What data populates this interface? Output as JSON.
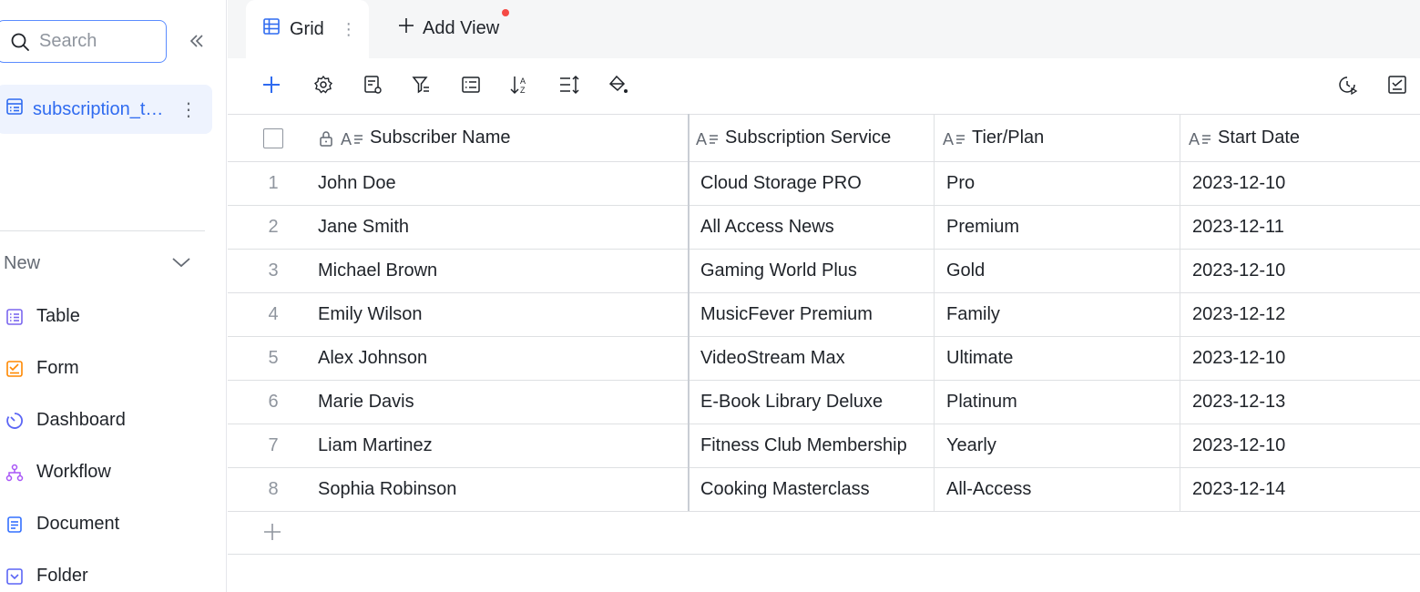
{
  "sidebar": {
    "search_placeholder": "Search",
    "active_table": "subscription_t…",
    "new_label": "New",
    "new_items": [
      {
        "label": "Table",
        "icon": "table-icon",
        "color": "#7b67ee"
      },
      {
        "label": "Form",
        "icon": "form-icon",
        "color": "#ff8800"
      },
      {
        "label": "Dashboard",
        "icon": "dashboard-icon",
        "color": "#5b65f5"
      },
      {
        "label": "Workflow",
        "icon": "workflow-icon",
        "color": "#a855f7"
      },
      {
        "label": "Document",
        "icon": "document-icon",
        "color": "#3370ff"
      },
      {
        "label": "Folder",
        "icon": "folder-icon",
        "color": "#5b65f5"
      }
    ]
  },
  "tabs": {
    "grid_label": "Grid",
    "add_view_label": "Add View"
  },
  "toolbar": {
    "icons": [
      "add-record-icon",
      "settings-icon",
      "field-settings-icon",
      "filter-icon",
      "group-icon",
      "sort-icon",
      "row-height-icon",
      "fill-color-icon"
    ],
    "right_icons": [
      "history-icon",
      "task-icon"
    ]
  },
  "grid": {
    "columns": [
      "Subscriber Name",
      "Subscription Service",
      "Tier/Plan",
      "Start Date"
    ],
    "rows": [
      {
        "num": "1",
        "name": "John Doe",
        "service": "Cloud Storage PRO",
        "tier": "Pro",
        "date": "2023-12-10"
      },
      {
        "num": "2",
        "name": "Jane Smith",
        "service": "All Access News",
        "tier": "Premium",
        "date": "2023-12-11"
      },
      {
        "num": "3",
        "name": "Michael Brown",
        "service": "Gaming World Plus",
        "tier": "Gold",
        "date": "2023-12-10"
      },
      {
        "num": "4",
        "name": "Emily Wilson",
        "service": "MusicFever Premium",
        "tier": "Family",
        "date": "2023-12-12"
      },
      {
        "num": "5",
        "name": "Alex Johnson",
        "service": "VideoStream Max",
        "tier": "Ultimate",
        "date": "2023-12-10"
      },
      {
        "num": "6",
        "name": "Marie Davis",
        "service": "E-Book Library Deluxe",
        "tier": "Platinum",
        "date": "2023-12-13"
      },
      {
        "num": "7",
        "name": "Liam Martinez",
        "service": "Fitness Club Membership",
        "tier": "Yearly",
        "date": "2023-12-10"
      },
      {
        "num": "8",
        "name": "Sophia Robinson",
        "service": "Cooking Masterclass",
        "tier": "All-Access",
        "date": "2023-12-14"
      }
    ]
  },
  "colors": {
    "accent": "#2f6bf0",
    "notification_dot": "#f54a45"
  }
}
